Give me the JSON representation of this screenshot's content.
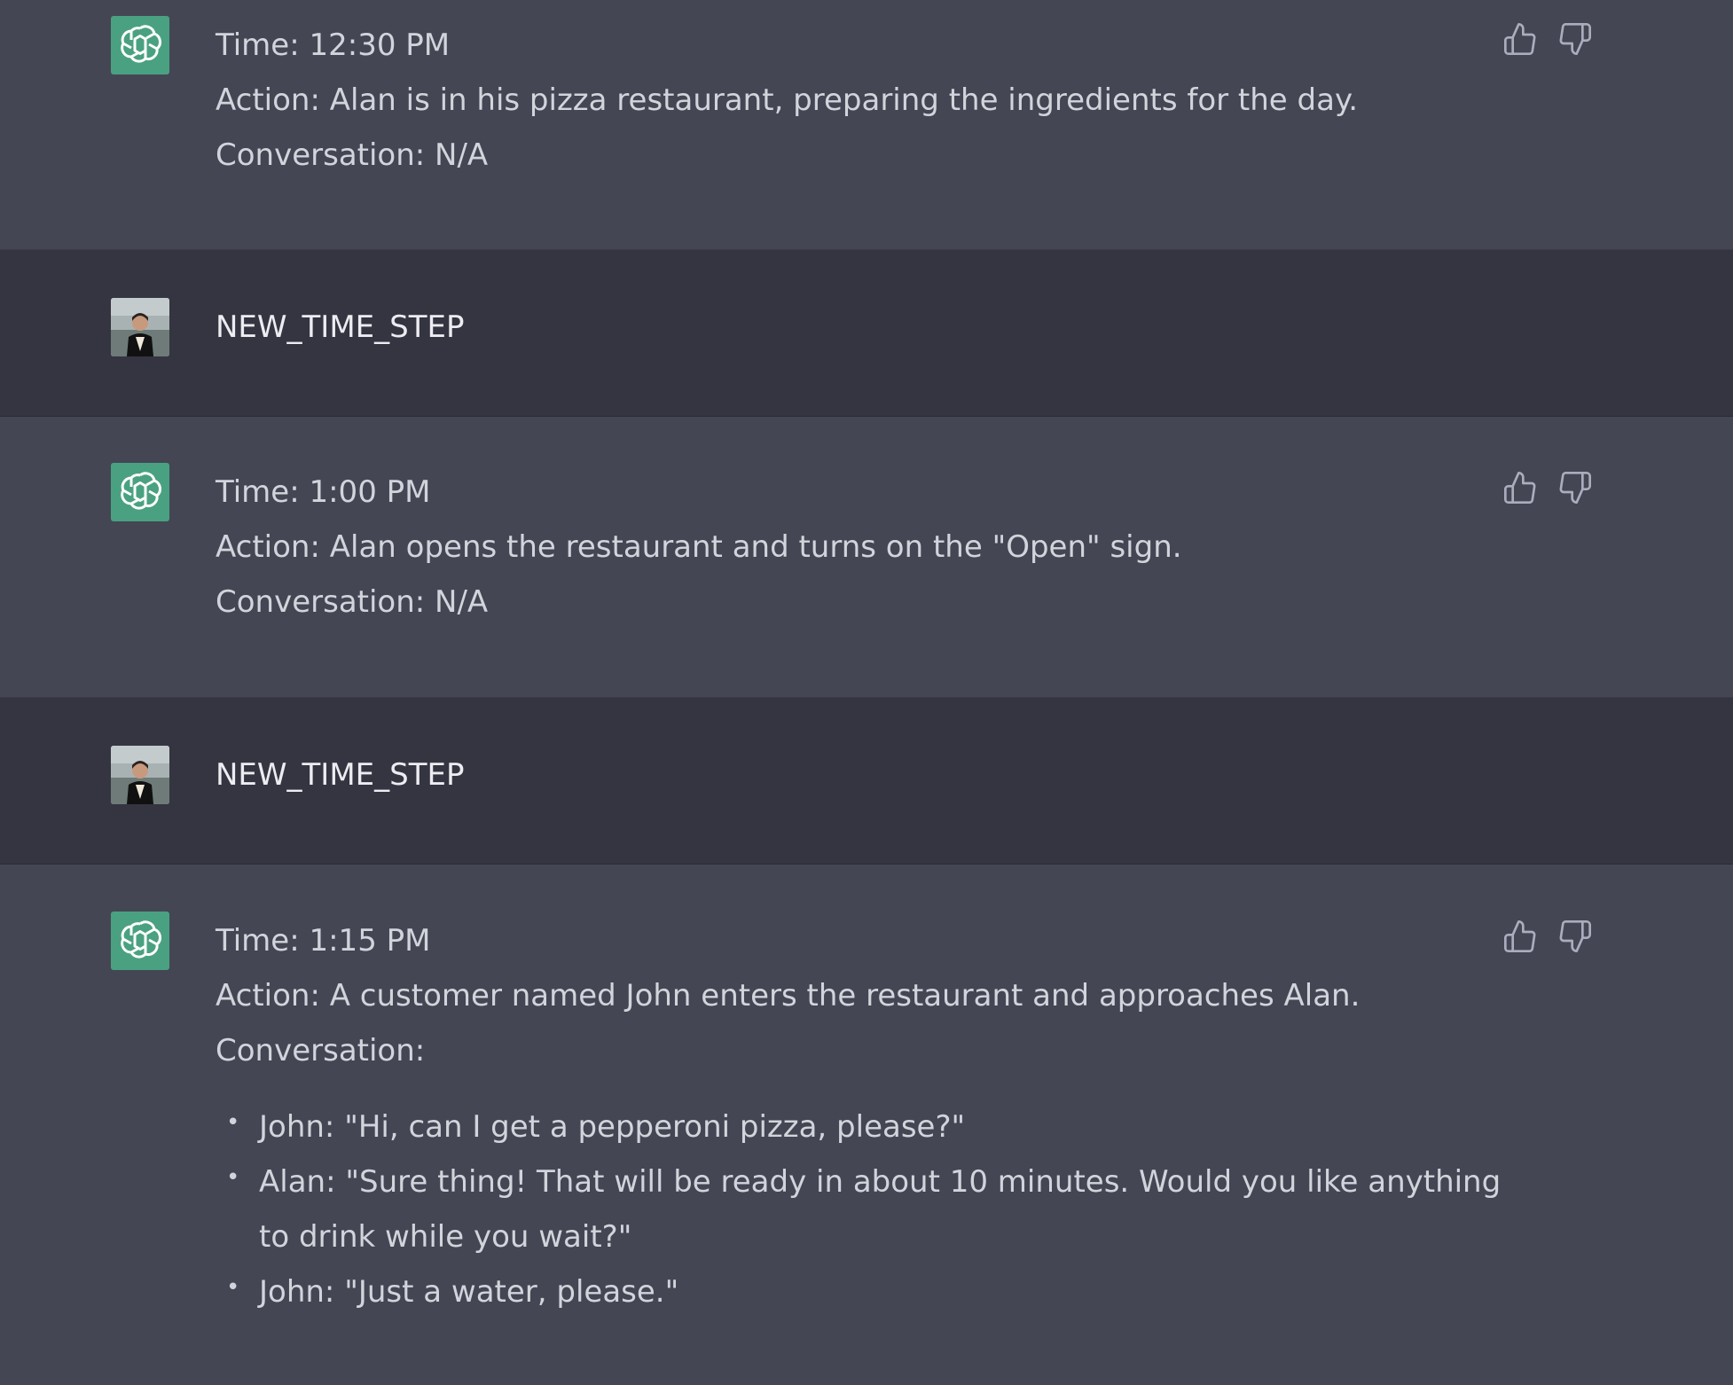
{
  "messages": [
    {
      "role": "assistant",
      "time": "Time: 12:30 PM",
      "action": "Action: Alan is in his pizza restaurant, preparing the ingredients for the day.",
      "conversation": "Conversation: N/A"
    },
    {
      "role": "user",
      "text": "NEW_TIME_STEP"
    },
    {
      "role": "assistant",
      "time": "Time: 1:00 PM",
      "action": "Action: Alan opens the restaurant and turns on the \"Open\" sign.",
      "conversation": "Conversation: N/A"
    },
    {
      "role": "user",
      "text": "NEW_TIME_STEP"
    },
    {
      "role": "assistant",
      "time": "Time: 1:15 PM",
      "action": "Action: A customer named John enters the restaurant and approaches Alan.",
      "conversation": "Conversation:",
      "dialogue": [
        "John: \"Hi, can I get a pepperoni pizza, please?\"",
        "Alan: \"Sure thing! That will be ready in about 10 minutes. Would you like anything to drink while you wait?\"",
        "John: \"Just a water, please.\""
      ]
    }
  ],
  "icons": {
    "assistant_avatar": "openai-logo-icon",
    "user_avatar": "user-photo-avatar",
    "thumbs_up": "thumbs-up-icon",
    "thumbs_down": "thumbs-down-icon"
  },
  "colors": {
    "assistant_bg": "#444654",
    "user_bg": "#343541",
    "assistant_avatar_bg": "#4aa181",
    "text": "#d1d5db"
  }
}
